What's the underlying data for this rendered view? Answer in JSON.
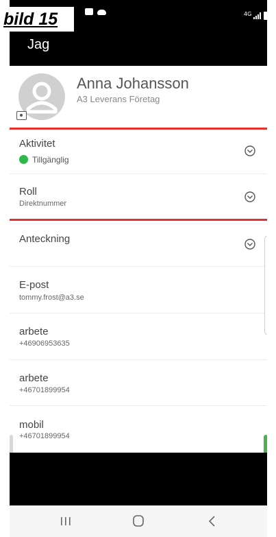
{
  "caption": "bild 15",
  "statusbar": {
    "network": "4G",
    "icons": [
      "shopping-bag-icon",
      "cloud-icon",
      "signal-icon",
      "battery-icon"
    ]
  },
  "appbar": {
    "title": "Jag"
  },
  "profile": {
    "name": "Anna Johansson",
    "company": "A3 Leverans Företag",
    "avatar_icon": "user-avatar-icon",
    "camera_icon": "camera-icon"
  },
  "rows": {
    "aktivitet": {
      "label": "Aktivitet",
      "value": "Tillgänglig",
      "status_color": "#2eb84a"
    },
    "roll": {
      "label": "Roll",
      "value": "Direktnummer"
    },
    "anteckning": {
      "label": "Anteckning"
    },
    "epost": {
      "label": "E-post",
      "value": "tommy.frost@a3.se"
    },
    "arbete1": {
      "label": "arbete",
      "value": "+46906953635"
    },
    "arbete2": {
      "label": "arbete",
      "value": "+46701899954"
    },
    "mobil": {
      "label": "mobil",
      "value": "+46701899954"
    }
  },
  "highlight_color": "#e53030",
  "navbar": {
    "buttons": [
      "recent-apps-icon",
      "home-icon",
      "back-icon"
    ]
  }
}
